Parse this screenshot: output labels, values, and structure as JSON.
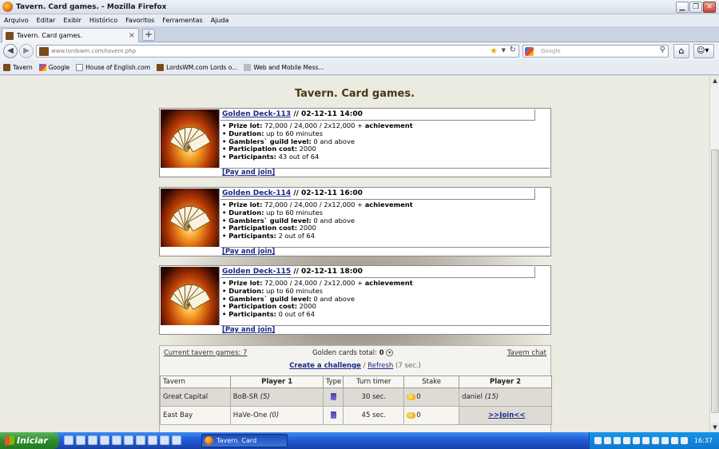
{
  "window": {
    "title": "Tavern. Card games. - Mozilla Firefox"
  },
  "menu": [
    "Arquivo",
    "Editar",
    "Exibir",
    "Histórico",
    "Favoritos",
    "Ferramentas",
    "Ajuda"
  ],
  "tab": {
    "label": "Tavern. Card games.",
    "close": "×",
    "new": "+"
  },
  "url": "www.lordswm.com/tavern.php",
  "search_placeholder": "Google",
  "bookmarks": [
    "Tavern",
    "Google",
    "House of English.com",
    "LordsWM.com Lords o...",
    "Web and Mobile Mess..."
  ],
  "page": {
    "title": "Tavern. Card games.",
    "tournaments": [
      {
        "name": "Golden Deck-113",
        "date": "// 02-12-11 14:00",
        "prize_label": "Prize lot:",
        "prize": " 72,000 / 24,000 / 2x12,000 + ",
        "prize_extra": "achievement",
        "duration_label": "Duration:",
        "duration": " up to 60 minutes",
        "guild_label": "Gamblers` guild level:",
        "guild": " 0 and above",
        "cost_label": "Participation cost:",
        "cost": " 2000",
        "participants_label": "Participants:",
        "participants": " 43 out of 64",
        "action": "[Pay and join]"
      },
      {
        "name": "Golden Deck-114",
        "date": "// 02-12-11 16:00",
        "prize_label": "Prize lot:",
        "prize": " 72,000 / 24,000 / 2x12,000 + ",
        "prize_extra": "achievement",
        "duration_label": "Duration:",
        "duration": " up to 60 minutes",
        "guild_label": "Gamblers` guild level:",
        "guild": " 0 and above",
        "cost_label": "Participation cost:",
        "cost": " 2000",
        "participants_label": "Participants:",
        "participants": " 2 out of 64",
        "action": "[Pay and join]"
      },
      {
        "name": "Golden Deck-115",
        "date": "// 02-12-11 18:00",
        "prize_label": "Prize lot:",
        "prize": " 72,000 / 24,000 / 2x12,000 + ",
        "prize_extra": "achievement",
        "duration_label": "Duration:",
        "duration": " up to 60 minutes",
        "guild_label": "Gamblers` guild level:",
        "guild": " 0 and above",
        "cost_label": "Participation cost:",
        "cost": " 2000",
        "participants_label": "Participants:",
        "participants": " 0 out of 64",
        "action": "[Pay and join]"
      }
    ],
    "panel": {
      "current_games": "Current tavern games: 7",
      "golden_label": "Golden cards total:",
      "golden_value": "0",
      "chat": "Tavern chat",
      "create": "Create a challenge",
      "sep": "/",
      "refresh": "Refresh",
      "refresh_time": "(7 sec.)",
      "columns": [
        "Tavern",
        "Player 1",
        "Type",
        "Turn timer",
        "Stake",
        "Player 2"
      ],
      "rows": [
        {
          "tavern": "Great Capital",
          "player1": "BoB-SR",
          "p1level": "(5)",
          "timer": "30 sec.",
          "stake": "0",
          "player2": "daniel",
          "p2level": "(15)"
        },
        {
          "tavern": "East Bay",
          "player1": "HaVe-One",
          "p1level": "(0)",
          "timer": "45 sec.",
          "stake": "0",
          "player2": ">>Join<<"
        }
      ]
    }
  },
  "taskbar": {
    "start": "Iniciar",
    "item": "Tavern. Card games....",
    "clock": "16:37"
  }
}
